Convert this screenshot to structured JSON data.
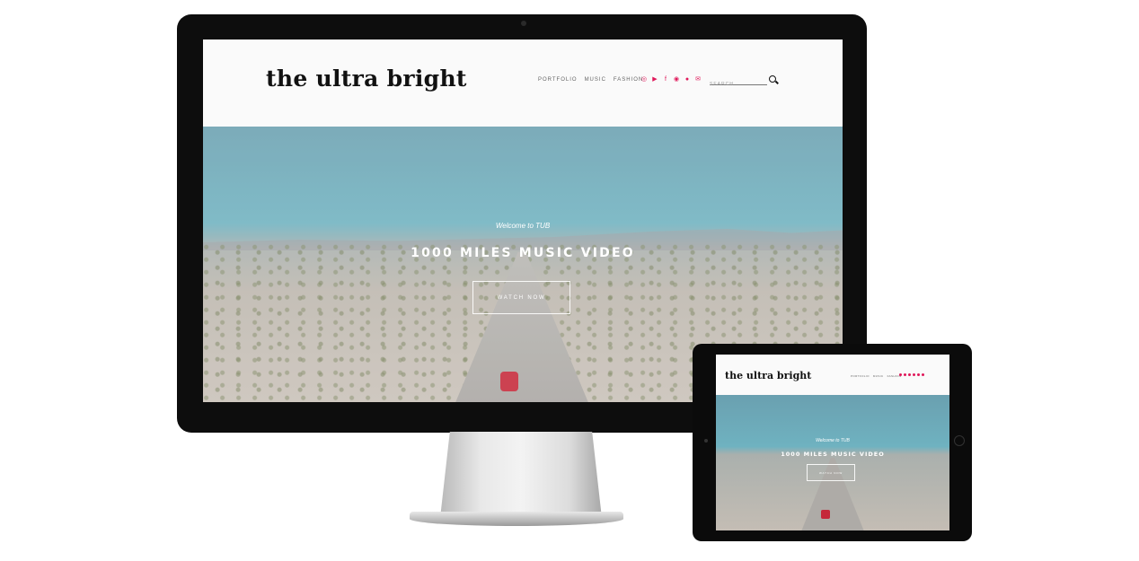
{
  "site": {
    "logo": "the ultra bright",
    "nav": [
      "PORTFOLIO",
      "MUSIC",
      "FASHION"
    ],
    "social_icons": [
      "instagram-icon",
      "youtube-icon",
      "facebook-icon",
      "spotify-icon",
      "github-icon",
      "email-icon"
    ],
    "search_placeholder": "SEARCH",
    "accent_color": "#e0185a"
  },
  "hero": {
    "subtitle": "Welcome to TUB",
    "title": "1000 MILES MUSIC VIDEO",
    "cta": "WATCH NOW"
  }
}
